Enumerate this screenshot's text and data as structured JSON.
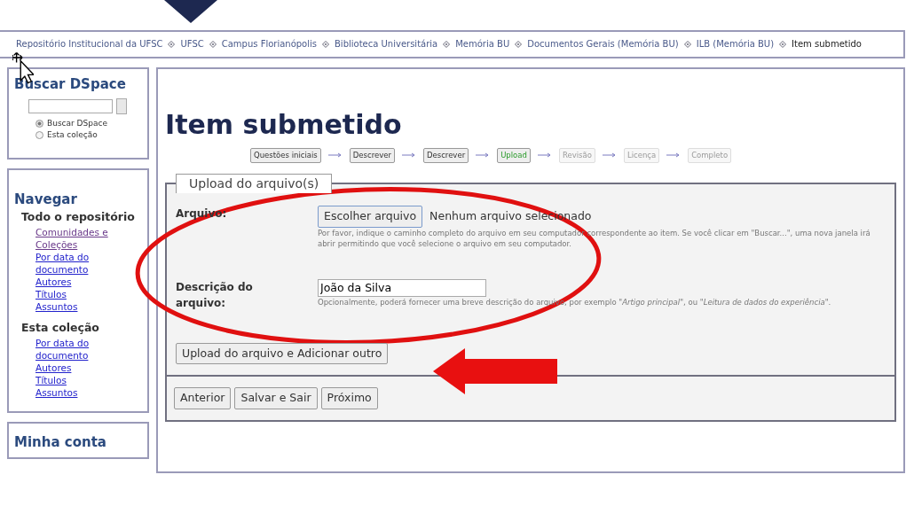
{
  "breadcrumb": [
    {
      "label": "Repositório Institucional da UFSC",
      "current": false
    },
    {
      "label": "UFSC",
      "current": false
    },
    {
      "label": "Campus Florianópolis",
      "current": false
    },
    {
      "label": "Biblioteca Universitária",
      "current": false
    },
    {
      "label": "Memória BU",
      "current": false
    },
    {
      "label": "Documentos Gerais (Memória BU)",
      "current": false
    },
    {
      "label": "ILB (Memória BU)",
      "current": false
    },
    {
      "label": "Item submetido",
      "current": true
    }
  ],
  "sidebar": {
    "search": {
      "title": "Buscar DSpace",
      "scope_options": [
        {
          "label": "Buscar DSpace",
          "selected": true
        },
        {
          "label": "Esta coleção",
          "selected": false
        }
      ]
    },
    "browse": {
      "title": "Navegar",
      "groups": [
        {
          "title": "Todo o repositório",
          "links": [
            {
              "label": "Comunidades e Coleções",
              "visited": true
            },
            {
              "label": "Por data do documento",
              "visited": false
            },
            {
              "label": "Autores",
              "visited": false
            },
            {
              "label": "Títulos",
              "visited": false
            },
            {
              "label": "Assuntos",
              "visited": false
            }
          ]
        },
        {
          "title": "Esta coleção",
          "links": [
            {
              "label": "Por data do documento",
              "visited": false
            },
            {
              "label": "Autores",
              "visited": false
            },
            {
              "label": "Títulos",
              "visited": false
            },
            {
              "label": "Assuntos",
              "visited": false
            }
          ]
        }
      ]
    },
    "account": {
      "title": "Minha conta"
    }
  },
  "main": {
    "title": "Item submetido",
    "progress": [
      {
        "label": "Questões iniciais",
        "selected": false,
        "disabled": false
      },
      {
        "label": "Descrever",
        "selected": false,
        "disabled": false
      },
      {
        "label": "Descrever",
        "selected": false,
        "disabled": false
      },
      {
        "label": "Upload",
        "selected": true,
        "disabled": false
      },
      {
        "label": "Revisão",
        "selected": false,
        "disabled": true
      },
      {
        "label": "Licença",
        "selected": false,
        "disabled": true
      },
      {
        "label": "Completo",
        "selected": false,
        "disabled": true
      }
    ],
    "fieldset": {
      "legend": "Upload do arquivo(s)",
      "file": {
        "label": "Arquivo:",
        "button": "Escolher arquivo",
        "status": "Nenhum arquivo selecionado",
        "help": "Por favor, indique o caminho completo do arquivo em seu computador correspondente ao item. Se você clicar em \"Buscar...\", uma nova janela irá abrir permitindo que você selecione o arquivo em seu computador."
      },
      "description": {
        "label": "Descrição do arquivo:",
        "value": "João da Silva",
        "help": "Opcionalmente, poderá fornecer uma breve descrição do arquivo, por exemplo *\"Artigo principal\"*, ou *\"Leitura de dados do experiência\"*."
      },
      "upload_button": "Upload do arquivo e Adicionar outro"
    },
    "nav_buttons": [
      "Anterior",
      "Salvar e Sair",
      "Próximo"
    ]
  }
}
